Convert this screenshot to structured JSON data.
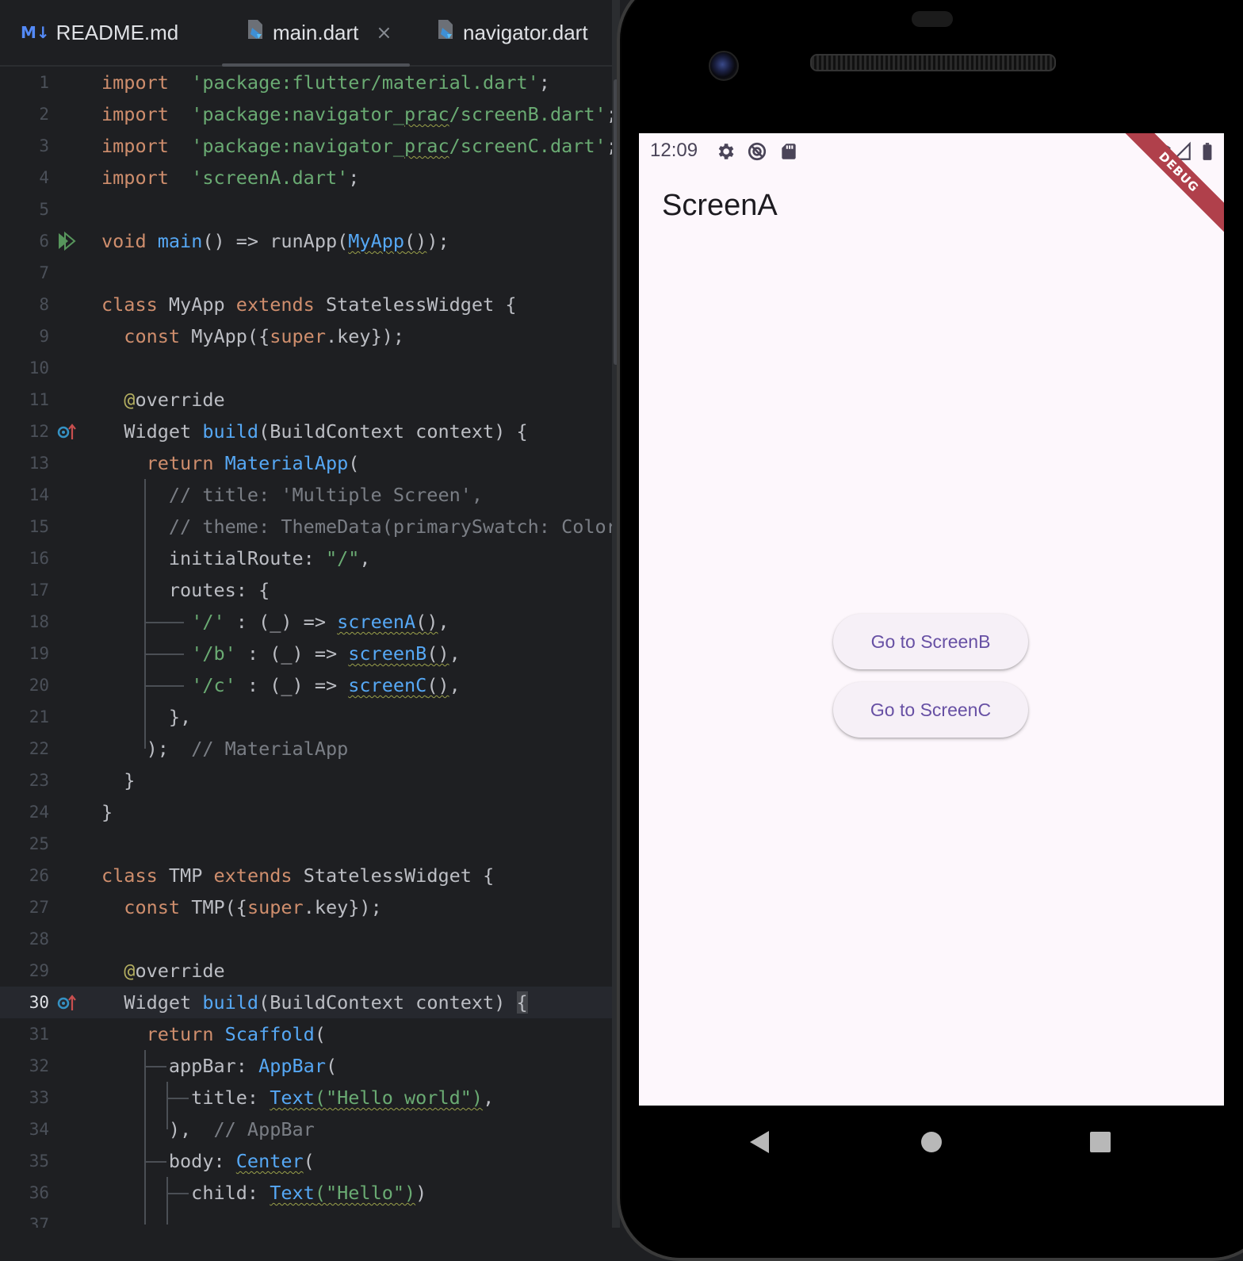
{
  "editor": {
    "tabs": [
      {
        "label": "README.md",
        "icon": "markdown-icon"
      },
      {
        "label": "main.dart",
        "icon": "dart-file-icon",
        "active": true
      },
      {
        "label": "navigator.dart",
        "icon": "dart-file-icon"
      }
    ],
    "current_line": 30,
    "line_numbers": [
      "1",
      "2",
      "3",
      "4",
      "5",
      "6",
      "7",
      "8",
      "9",
      "10",
      "11",
      "12",
      "13",
      "14",
      "15",
      "16",
      "17",
      "18",
      "19",
      "20",
      "21",
      "22",
      "23",
      "24",
      "25",
      "26",
      "27",
      "28",
      "29",
      "30",
      "31",
      "32",
      "33",
      "34",
      "35",
      "36",
      "37"
    ],
    "lines": [
      [
        [
          "kw",
          "import"
        ],
        [
          "",
          "  "
        ],
        [
          "str",
          "'package:flutter/material.dart'"
        ],
        [
          "",
          ";"
        ]
      ],
      [
        [
          "kw",
          "import"
        ],
        [
          "",
          "  "
        ],
        [
          "str",
          "'package:navigator_"
        ],
        [
          "str sq",
          "prac"
        ],
        [
          "str",
          "/screenB.dart'"
        ],
        [
          "",
          ";"
        ]
      ],
      [
        [
          "kw",
          "import"
        ],
        [
          "",
          "  "
        ],
        [
          "str",
          "'package:navigator_"
        ],
        [
          "str sq",
          "prac"
        ],
        [
          "str",
          "/screenC.dart'"
        ],
        [
          "",
          ";"
        ]
      ],
      [
        [
          "kw",
          "import"
        ],
        [
          "",
          "  "
        ],
        [
          "str",
          "'screenA.dart'"
        ],
        [
          "",
          ";"
        ]
      ],
      [],
      [
        [
          "kw",
          "void"
        ],
        [
          "",
          " "
        ],
        [
          "fn",
          "main"
        ],
        [
          "",
          "() => runApp("
        ],
        [
          "fn sq",
          "MyApp"
        ],
        [
          "sq",
          "()"
        ],
        [
          "",
          ");"
        ]
      ],
      [],
      [
        [
          "kw",
          "class"
        ],
        [
          "",
          " MyApp "
        ],
        [
          "kw",
          "extends"
        ],
        [
          "",
          " StatelessWidget {"
        ]
      ],
      [
        [
          "",
          "  "
        ],
        [
          "kw",
          "const"
        ],
        [
          "",
          " MyApp({"
        ],
        [
          "kw",
          "super"
        ],
        [
          "",
          ".key});"
        ]
      ],
      [],
      [
        [
          "",
          "  "
        ],
        [
          "ann",
          "@"
        ],
        [
          "",
          "override"
        ]
      ],
      [
        [
          "",
          "  Widget "
        ],
        [
          "fn",
          "build"
        ],
        [
          "",
          "(BuildContext context) {"
        ]
      ],
      [
        [
          "",
          "    "
        ],
        [
          "kw",
          "return"
        ],
        [
          "",
          " "
        ],
        [
          "fn",
          "MaterialApp"
        ],
        [
          "",
          "("
        ]
      ],
      [
        [
          "",
          "      "
        ],
        [
          "cm",
          "// title: 'Multiple Screen',"
        ]
      ],
      [
        [
          "",
          "      "
        ],
        [
          "cm",
          "// theme: ThemeData(primarySwatch: Colors.blue),"
        ]
      ],
      [
        [
          "",
          "      initialRoute: "
        ],
        [
          "str",
          "\"/\""
        ],
        [
          "",
          ","
        ]
      ],
      [
        [
          "",
          "      routes: {"
        ]
      ],
      [
        [
          "",
          "        "
        ],
        [
          "str",
          "'/'"
        ],
        [
          "",
          " : (_) => "
        ],
        [
          "fn sq",
          "screenA"
        ],
        [
          "sq",
          "()"
        ],
        [
          "",
          ","
        ]
      ],
      [
        [
          "",
          "        "
        ],
        [
          "str",
          "'/b'"
        ],
        [
          "",
          " : (_) => "
        ],
        [
          "fn sq",
          "screenB"
        ],
        [
          "sq",
          "()"
        ],
        [
          "",
          ","
        ]
      ],
      [
        [
          "",
          "        "
        ],
        [
          "str",
          "'/c'"
        ],
        [
          "",
          " : (_) => "
        ],
        [
          "fn sq",
          "screenC"
        ],
        [
          "sq",
          "()"
        ],
        [
          "",
          ","
        ]
      ],
      [
        [
          "",
          "      },"
        ]
      ],
      [
        [
          "",
          "    );  "
        ],
        [
          "cm",
          "// MaterialApp"
        ]
      ],
      [
        [
          "",
          "  }"
        ]
      ],
      [
        [
          "",
          "}"
        ]
      ],
      [],
      [
        [
          "kw",
          "class"
        ],
        [
          "",
          " TMP "
        ],
        [
          "kw",
          "extends"
        ],
        [
          "",
          " StatelessWidget {"
        ]
      ],
      [
        [
          "",
          "  "
        ],
        [
          "kw",
          "const"
        ],
        [
          "",
          " TMP({"
        ],
        [
          "kw",
          "super"
        ],
        [
          "",
          ".key});"
        ]
      ],
      [],
      [
        [
          "",
          "  "
        ],
        [
          "ann",
          "@"
        ],
        [
          "",
          "override"
        ]
      ],
      [
        [
          "",
          "  Widget "
        ],
        [
          "fn",
          "build"
        ],
        [
          "",
          "(BuildContext context) "
        ],
        [
          "bracemark",
          "{"
        ]
      ],
      [
        [
          "",
          "    "
        ],
        [
          "kw",
          "return"
        ],
        [
          "",
          " "
        ],
        [
          "fn",
          "Scaffold"
        ],
        [
          "",
          "("
        ]
      ],
      [
        [
          "",
          "      appBar: "
        ],
        [
          "fn",
          "AppBar"
        ],
        [
          "",
          "("
        ]
      ],
      [
        [
          "",
          "        title: "
        ],
        [
          "fn sq",
          "Text"
        ],
        [
          "str sq",
          "(\"Hello world\")"
        ],
        [
          "",
          ","
        ]
      ],
      [
        [
          "",
          "      ),  "
        ],
        [
          "cm",
          "// AppBar"
        ]
      ],
      [
        [
          "",
          "      body: "
        ],
        [
          "fn sq",
          "Center"
        ],
        [
          "",
          "("
        ]
      ],
      [
        [
          "",
          "        child: "
        ],
        [
          "fn sq",
          "Text"
        ],
        [
          "str sq",
          "(\"Hello\")"
        ],
        [
          "",
          ")"
        ]
      ],
      [
        [
          "",
          "        "
        ]
      ]
    ]
  },
  "phone": {
    "status_time": "12:09",
    "app_title": "ScreenA",
    "debug_banner": "DEBUG",
    "buttons": [
      "Go to ScreenB",
      "Go to ScreenC"
    ],
    "accent_color": "#6750a4",
    "background_color": "#fdf7fc"
  }
}
